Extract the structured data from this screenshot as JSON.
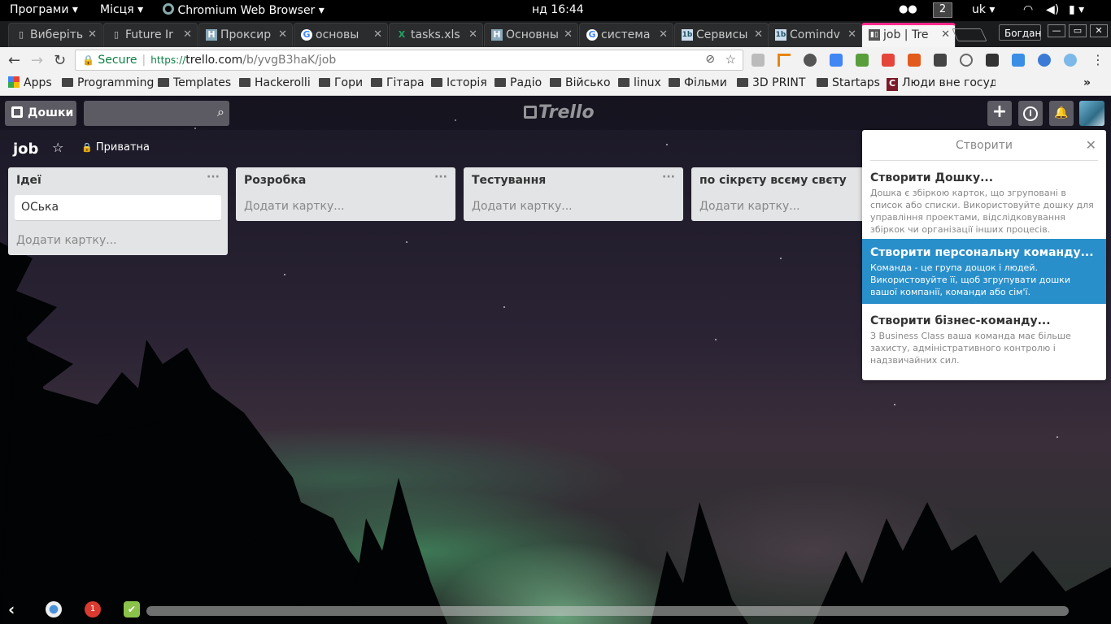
{
  "system_bar": {
    "programs": "Програми",
    "places": "Місця",
    "active_app": "Chromium Web Browser",
    "clock": "нд 16:44",
    "workspace": "2",
    "keyboard_layout": "uk"
  },
  "tabs": [
    {
      "title": "Виберіть",
      "favicon": "doc-icon"
    },
    {
      "title": "Future Ir",
      "favicon": "doc-icon"
    },
    {
      "title": "Проксир",
      "favicon": "H"
    },
    {
      "title": "основы",
      "favicon": "G"
    },
    {
      "title": "tasks.xls",
      "favicon": "X"
    },
    {
      "title": "Основны",
      "favicon": "H"
    },
    {
      "title": "система",
      "favicon": "G"
    },
    {
      "title": "Сервисы",
      "favicon": "1b"
    },
    {
      "title": "Comindv",
      "favicon": "1b"
    },
    {
      "title": "job | Tre",
      "favicon": "trello"
    }
  ],
  "window": {
    "user": "Богдан"
  },
  "omnibox": {
    "secure_label": "Secure",
    "scheme": "https://",
    "host": "trello.com",
    "path": "/b/yvgB3haK/job"
  },
  "bookmarks": [
    {
      "label": "Apps",
      "icon": "apps-grid-icon"
    },
    {
      "label": "Programming",
      "icon": "folder-icon"
    },
    {
      "label": "Templates",
      "icon": "folder-icon"
    },
    {
      "label": "Hackerolli",
      "icon": "folder-icon"
    },
    {
      "label": "Гори",
      "icon": "folder-icon"
    },
    {
      "label": "Гітара",
      "icon": "folder-icon"
    },
    {
      "label": "Історія",
      "icon": "folder-icon"
    },
    {
      "label": "Радіо",
      "icon": "folder-icon"
    },
    {
      "label": "Військо",
      "icon": "folder-icon"
    },
    {
      "label": "linux",
      "icon": "folder-icon"
    },
    {
      "label": "Фільми",
      "icon": "folder-icon"
    },
    {
      "label": "3D PRINT",
      "icon": "folder-icon"
    },
    {
      "label": "Startaps",
      "icon": "folder-icon"
    },
    {
      "label": "Люди вне госуда",
      "icon": "c-icon"
    }
  ],
  "trello": {
    "boards_button": "Дошки",
    "logo": "Trello",
    "board": {
      "name": "job",
      "visibility": "Приватна"
    },
    "lists": [
      {
        "title": "Ідеї",
        "cards": [
          "ОСька"
        ],
        "add_card": "Додати картку..."
      },
      {
        "title": "Розробка",
        "cards": [],
        "add_card": "Додати картку..."
      },
      {
        "title": "Тестування",
        "cards": [],
        "add_card": "Додати картку..."
      },
      {
        "title": "по сікрєту всєму свєту",
        "cards": [],
        "add_card": "Додати картку..."
      }
    ],
    "create_popover": {
      "title": "Створити",
      "items": [
        {
          "title": "Створити Дошку...",
          "desc": "Дошка є збіркою карток, що згруповані в список або списки. Використовуйте дошку для управління проектами, відслідковування збіркок чи організації інших процесів."
        },
        {
          "title": "Створити персональну команду...",
          "desc": "Команда - це група дощок і людей. Використовуйте її, щоб згрупувати дошки вашої компанії, команди або сім'ї."
        },
        {
          "title": "Створити бізнес-команду...",
          "desc": "З Business Class ваша команда має більше захисту, адміністративного контролю і надзвичайних сил."
        }
      ]
    }
  },
  "dock": {
    "badge_count": "1"
  }
}
